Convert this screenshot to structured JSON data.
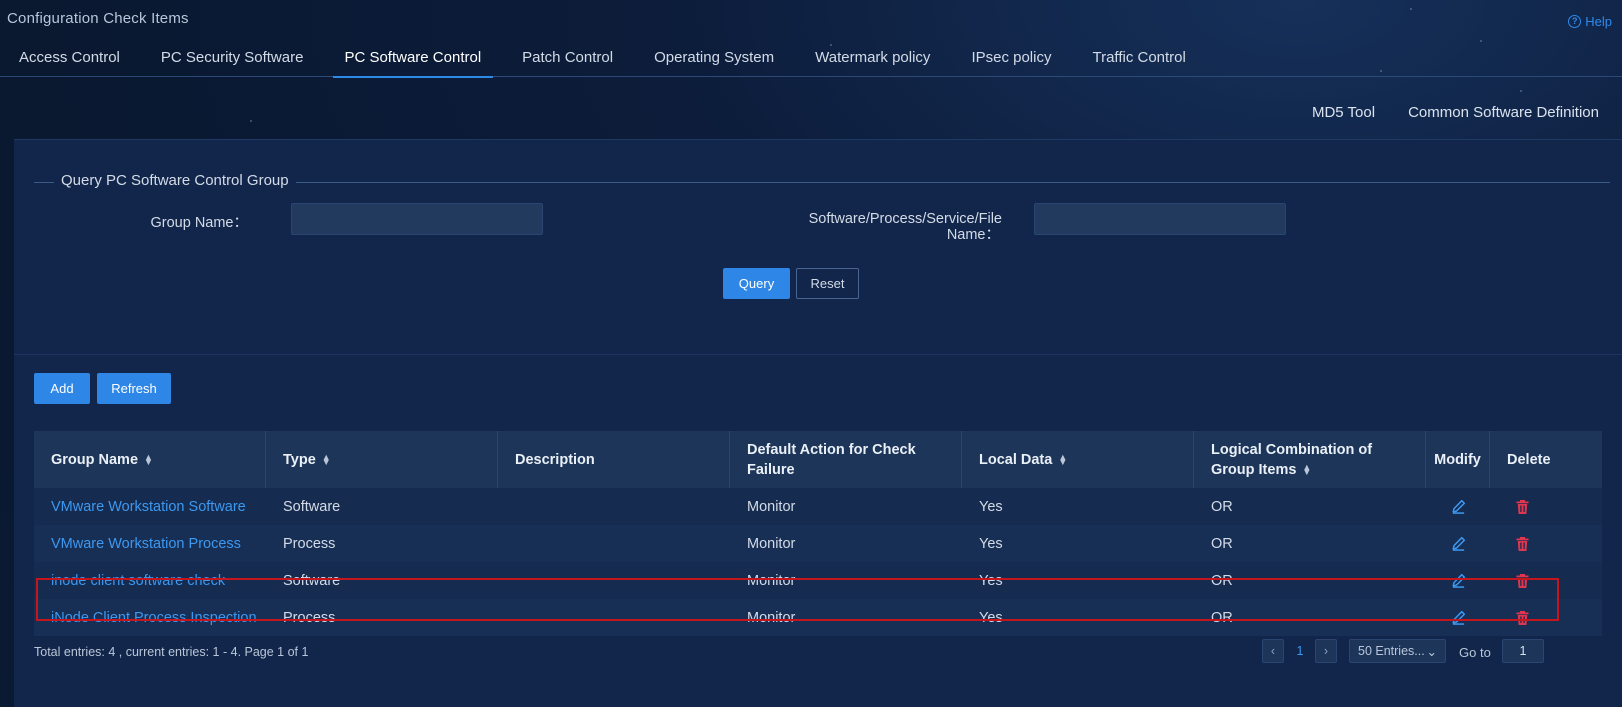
{
  "page_title": "Configuration Check Items",
  "help_label": "Help",
  "tabs": [
    {
      "label": "Access Control",
      "active": false
    },
    {
      "label": "PC Security Software",
      "active": false
    },
    {
      "label": "PC Software Control",
      "active": true
    },
    {
      "label": "Patch Control",
      "active": false
    },
    {
      "label": "Operating System",
      "active": false
    },
    {
      "label": "Watermark policy",
      "active": false
    },
    {
      "label": "IPsec policy",
      "active": false
    },
    {
      "label": "Traffic Control",
      "active": false
    }
  ],
  "top_links": {
    "md5_tool": "MD5 Tool",
    "common_software": "Common Software Definition"
  },
  "query": {
    "legend": "Query PC Software Control Group",
    "group_name_label": "Group Name：",
    "group_name_value": "",
    "software_label_line1": "Software/Process/Service/File",
    "software_label_line2": "Name：",
    "software_value": "",
    "query_button": "Query",
    "reset_button": "Reset"
  },
  "actions": {
    "add": "Add",
    "refresh": "Refresh"
  },
  "table": {
    "headers": {
      "group_name": "Group Name",
      "type": "Type",
      "description": "Description",
      "default_action": "Default Action for Check Failure",
      "local_data": "Local Data",
      "logical": "Logical Combination of Group Items",
      "modify": "Modify",
      "delete": "Delete"
    },
    "rows": [
      {
        "group_name": "VMware Workstation Software",
        "type": "Software",
        "description": "",
        "default_action": "Monitor",
        "local_data": "Yes",
        "logical": "OR"
      },
      {
        "group_name": "VMware Workstation Process",
        "type": "Process",
        "description": "",
        "default_action": "Monitor",
        "local_data": "Yes",
        "logical": "OR"
      },
      {
        "group_name": "inode client software check",
        "type": "Software",
        "description": "",
        "default_action": "Monitor",
        "local_data": "Yes",
        "logical": "OR"
      },
      {
        "group_name": "iNode Client Process Inspection",
        "type": "Process",
        "description": "",
        "default_action": "Monitor",
        "local_data": "Yes",
        "logical": "OR"
      }
    ]
  },
  "footer": {
    "summary": "Total entries: 4 , current entries: 1 - 4. Page 1 of 1",
    "current_page": "1",
    "page_size": "50 Entries...",
    "goto_label": "Go to",
    "goto_value": "1"
  },
  "colors": {
    "accent": "#2e86e6",
    "link": "#3d98f0",
    "delete": "#e0364f",
    "highlight": "#c5161d"
  }
}
